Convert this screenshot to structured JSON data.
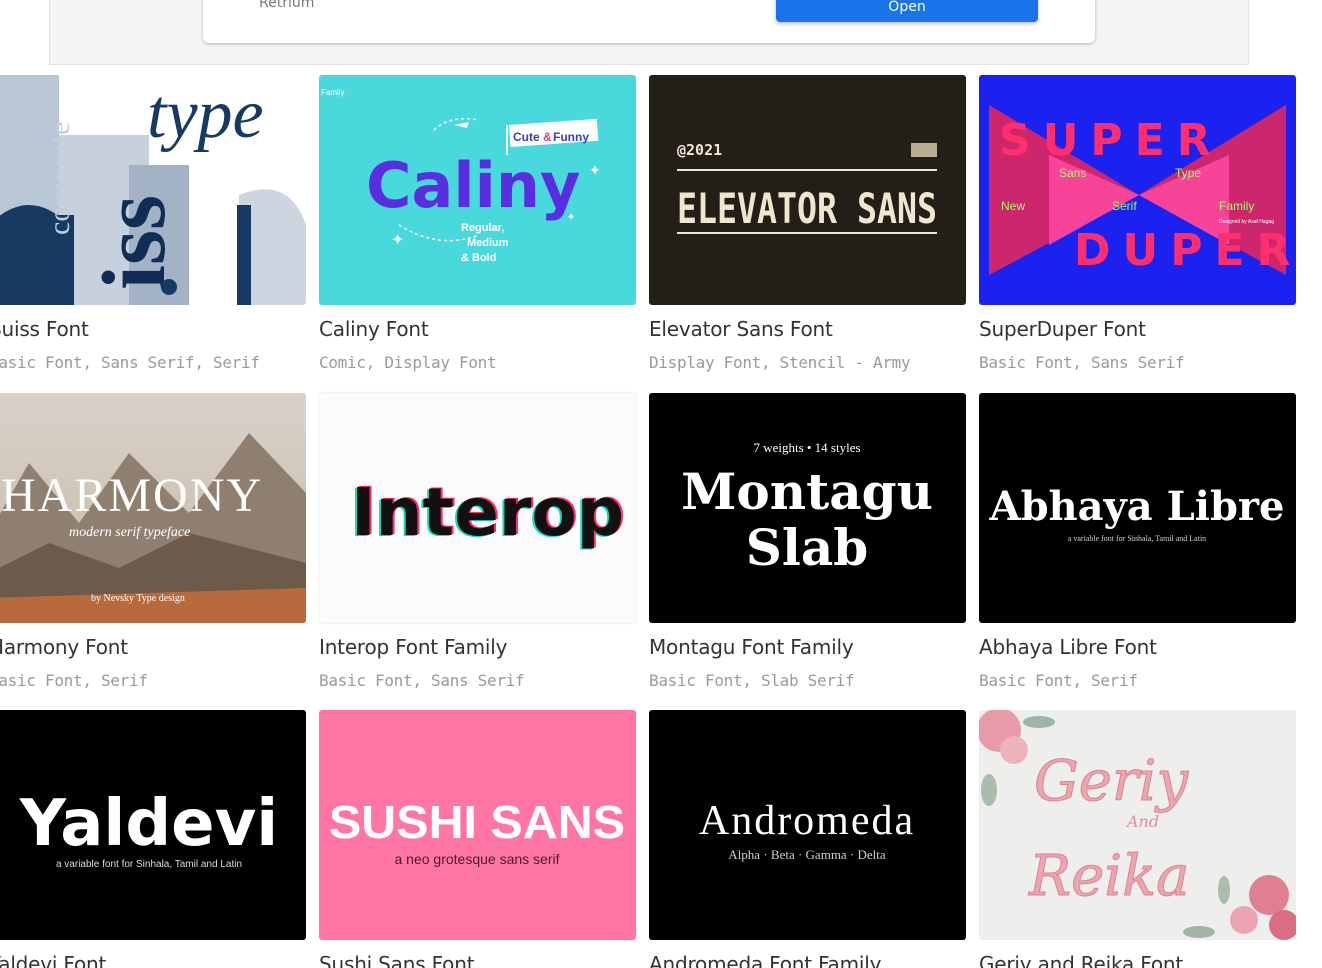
{
  "ad": {
    "advertiser": "Retrium",
    "open_label": "Open"
  },
  "fonts": [
    {
      "title": "Suiss Font",
      "tags": "Basic Font, Sans Serif, Serif",
      "preview_text": [
        "type",
        "corporate",
        "iss"
      ]
    },
    {
      "title": "Caliny Font",
      "tags": "Comic, Display Font",
      "preview_text": [
        "Caliny",
        "Cute",
        "&",
        "Funny",
        "Regular,",
        "Medium",
        "& Bold",
        "Family"
      ]
    },
    {
      "title": "Elevator Sans Font",
      "tags": "Display Font, Stencil - Army",
      "preview_text": [
        "@2021",
        "ELEVATOR SANS"
      ]
    },
    {
      "title": "SuperDuper Font",
      "tags": "Basic Font, Sans Serif",
      "preview_text": [
        "SUPER",
        "DUPER",
        "New",
        "Sans",
        "Serif",
        "Type",
        "Family",
        "Designed by Asaf Hagag"
      ]
    },
    {
      "title": "Harmony Font",
      "tags": "Basic Font, Serif",
      "preview_text": [
        "HARMONY",
        "modern serif typeface",
        "by Nevsky Type design"
      ]
    },
    {
      "title": "Interop Font Family",
      "tags": "Basic Font, Sans Serif",
      "preview_text": [
        "Interop"
      ]
    },
    {
      "title": "Montagu Font Family",
      "tags": "Basic Font, Slab Serif",
      "preview_text": [
        "7 weights • 14 styles",
        "Montagu",
        "Slab"
      ]
    },
    {
      "title": "Abhaya Libre Font",
      "tags": "Basic Font, Serif",
      "preview_text": [
        "Abhaya Libre",
        "a variable font for Sinhala, Tamil and Latin"
      ]
    },
    {
      "title": "Yaldevi Font",
      "tags": "",
      "preview_text": [
        "Yaldevi",
        "a variable font for Sinhala, Tamil and Latin"
      ]
    },
    {
      "title": "Sushi Sans Font",
      "tags": "",
      "preview_text": [
        "SUSHI SANS",
        "a neo grotesque sans serif"
      ]
    },
    {
      "title": "Andromeda Font Family",
      "tags": "",
      "preview_text": [
        "Andromeda",
        "Alpha · Beta · Gamma · Delta"
      ]
    },
    {
      "title": "Geriy and Reika Font",
      "tags": "",
      "preview_text": [
        "Geriy",
        "And",
        "Reika"
      ]
    }
  ]
}
